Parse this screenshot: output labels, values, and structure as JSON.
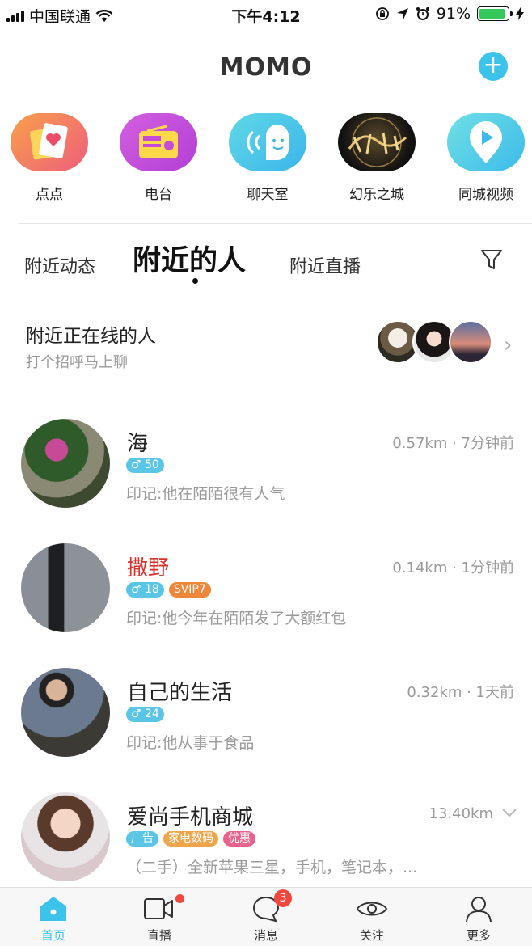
{
  "status_bar": {
    "carrier": "中国联通",
    "time": "下午4:12",
    "battery": "91%",
    "battery_level": 0.91
  },
  "header": {
    "logo": "MOMO",
    "add_icon": "plus-icon"
  },
  "shortcuts": [
    {
      "label": "点点",
      "icon": "heart-cards-icon"
    },
    {
      "label": "电台",
      "icon": "radio-icon"
    },
    {
      "label": "聊天室",
      "icon": "chat-face-icon"
    },
    {
      "label": "幻乐之城",
      "icon": "fantasy-city-logo"
    },
    {
      "label": "同城视频",
      "icon": "play-pin-icon"
    }
  ],
  "tabs": {
    "nearby_feed": "附近动态",
    "nearby_people": "附近的人",
    "nearby_live": "附近直播",
    "active": "附近的人"
  },
  "online": {
    "title": "附近正在线的人",
    "subtitle": "打个招呼马上聊"
  },
  "people": [
    {
      "name": "海",
      "meta": "0.57km · 7分钟前",
      "badges": [
        {
          "text": "♂ 50",
          "kind": "male"
        }
      ],
      "signature": "印记:他在陌陌很有人气",
      "vip": false
    },
    {
      "name": "撒野",
      "meta": "0.14km · 1分钟前",
      "badges": [
        {
          "text": "♂ 18",
          "kind": "male"
        },
        {
          "text": "SVIP7",
          "kind": "svip"
        }
      ],
      "signature": "印记:他今年在陌陌发了大额红包",
      "vip": true
    },
    {
      "name": "自己的生活",
      "meta": "0.32km · 1天前",
      "badges": [
        {
          "text": "♂ 24",
          "kind": "male"
        }
      ],
      "signature": "印记:他从事于食品",
      "vip": false
    },
    {
      "name": "爱尚手机商城",
      "meta": "13.40km",
      "badges": [
        {
          "text": "广告",
          "kind": "ad"
        },
        {
          "text": "家电数码",
          "kind": "cat"
        },
        {
          "text": "优惠",
          "kind": "deal"
        }
      ],
      "signature": "（二手）全新苹果三星，手机，笔记本，...",
      "vip": false
    }
  ],
  "tabbar": [
    {
      "label": "首页",
      "icon": "home-icon",
      "active": true
    },
    {
      "label": "直播",
      "icon": "video-camera-icon",
      "dot": true
    },
    {
      "label": "消息",
      "icon": "chat-bubble-icon",
      "count": "3"
    },
    {
      "label": "关注",
      "icon": "eye-icon"
    },
    {
      "label": "更多",
      "icon": "person-icon"
    }
  ],
  "colors": {
    "accent": "#3cc3ea",
    "vip_name": "#d9302c",
    "badge_red": "#f0483e"
  }
}
